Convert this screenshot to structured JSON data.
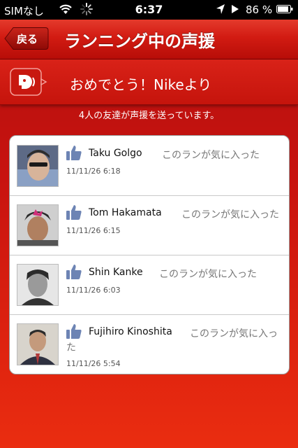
{
  "status_bar": {
    "carrier": "SIMなし",
    "time": "6:37",
    "battery_pct": "86 %"
  },
  "nav": {
    "back_label": "戻る",
    "title": "ランニング中の声援"
  },
  "banner": {
    "text": "おめでとう！Nikeより"
  },
  "subtitle": "4人の友達が声援を送っています。",
  "cheers": [
    {
      "name": "Taku Golgo",
      "action": "このランが気に入った",
      "time": "11/11/26 6:18"
    },
    {
      "name": "Tom Hakamata",
      "action": "このランが気に入った",
      "time": "11/11/26 6:15"
    },
    {
      "name": "Shin Kanke",
      "action": "このランが気に入った",
      "time": "11/11/26 6:03"
    },
    {
      "name": "Fujihiro Kinoshita",
      "action_line1": "このランが気に入っ",
      "action_line2": "た",
      "time": "11/11/26 5:54"
    }
  ],
  "colors": {
    "brand_red": "#c8130f",
    "like_blue": "#6d84b4"
  }
}
